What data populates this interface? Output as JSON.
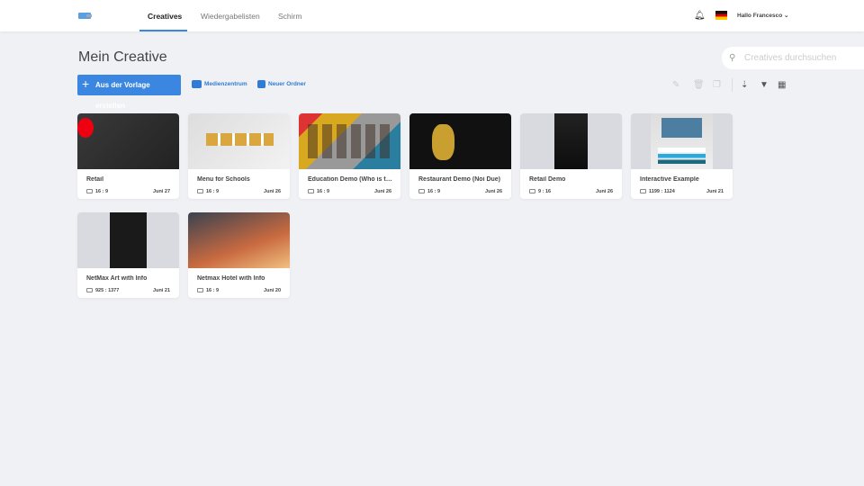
{
  "header": {
    "tabs": [
      {
        "label": "Creatives",
        "active": true
      },
      {
        "label": "Wiedergabelisten"
      },
      {
        "label": "Schirm"
      }
    ],
    "user": "Hallo Francesco",
    "icons": [
      "bell-icon",
      "flag-de-icon",
      "chevron-down-icon"
    ]
  },
  "page": {
    "title": "Mein Creative",
    "search_placeholder": "Creatives durchsuchen",
    "create_button": "Aus der Vorlage erstellen",
    "media_link": "Medienzentrum",
    "folder_link": "Neuer Ordner"
  },
  "accent": "#3b86e0",
  "creatives": [
    {
      "name": "Retail",
      "ratio": "16 : 9",
      "date": "Juni 27"
    },
    {
      "name": "Menu for Schools",
      "ratio": "16 : 9",
      "date": "Juni 26"
    },
    {
      "name": "Education Demo (Who is th...",
      "ratio": "16 : 9",
      "date": "Juni 26"
    },
    {
      "name": "Restaurant Demo (Noi Due)",
      "ratio": "16 : 9",
      "date": "Juni 26"
    },
    {
      "name": "Retail Demo",
      "ratio": "9 : 16",
      "date": "Juni 26"
    },
    {
      "name": "Interactive Example",
      "ratio": "1199 : 1124",
      "date": "Juni 21"
    },
    {
      "name": "NetMax Art with Info",
      "ratio": "925 : 1377",
      "date": "Juni 21"
    },
    {
      "name": "Netmax Hotel with Info",
      "ratio": "16 : 9",
      "date": "Juni 20"
    }
  ]
}
